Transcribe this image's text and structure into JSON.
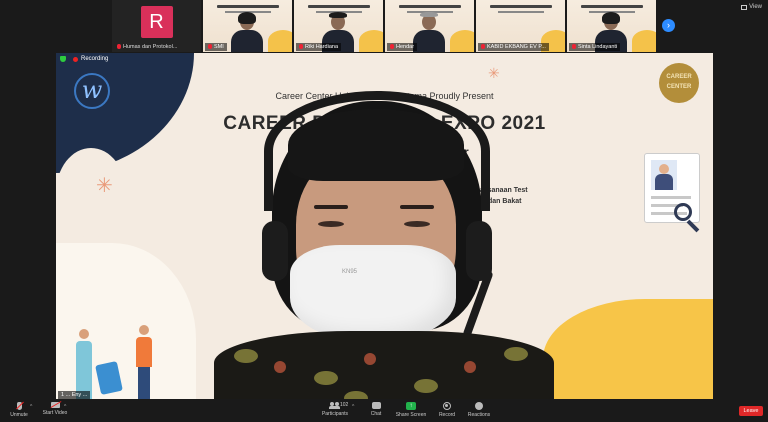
{
  "gallery": {
    "tiles": [
      {
        "type": "avatar",
        "initial": "R",
        "name": "Humas dan Protokol..."
      },
      {
        "type": "video",
        "name": "SMI"
      },
      {
        "type": "video",
        "name": "Riki Hardiana"
      },
      {
        "type": "video",
        "name": "Hendar"
      },
      {
        "type": "video",
        "name": "KABID EKBANG EV P..."
      },
      {
        "type": "video",
        "name": "Sinta Lindayanti"
      }
    ],
    "view_label": "View"
  },
  "recording": {
    "label": "Recording"
  },
  "main": {
    "slide": {
      "top_line": "Career Center Universitas Widyatama Proudly Present",
      "title": "CAREER D...  VIRTUAL EXPO 2021",
      "subtitle": "Care...                     ...p Expo, dan Webinar",
      "side_line1": "...aksanaan Test",
      "side_line2": "...at dan Bakat",
      "badge": "CAREER CENTER",
      "logo": "w"
    },
    "speaker_tag": "1 ... Eny ..."
  },
  "toolbar": {
    "unmute": "Unmute",
    "start_video": "Start Video",
    "participants": "Participants",
    "participants_count": "102",
    "chat": "Chat",
    "share_screen": "Share Screen",
    "record": "Record",
    "reactions": "Reactions",
    "leave": "Leave"
  },
  "colors": {
    "avatar_bg": "#d9305a",
    "share_green": "#22b24c",
    "leave_red": "#e02828",
    "accent_blue": "#2d8cff"
  }
}
